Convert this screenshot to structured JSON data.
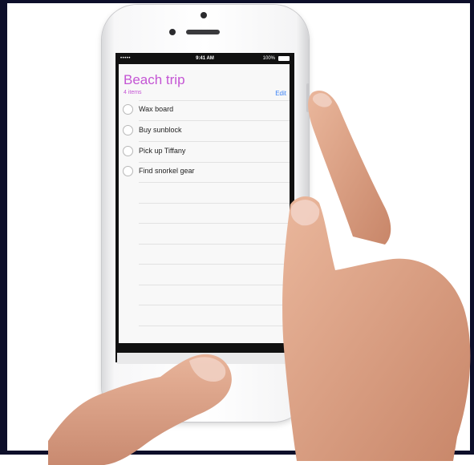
{
  "status_bar": {
    "signal": "•••••",
    "time": "9:41 AM",
    "battery": "100%"
  },
  "list": {
    "title": "Beach trip",
    "count": "4 items",
    "edit_label": "Edit",
    "items": [
      {
        "label": "Wax board"
      },
      {
        "label": "Buy sunblock"
      },
      {
        "label": "Pick up Tiffany"
      },
      {
        "label": "Find snorkel gear"
      }
    ]
  },
  "colors": {
    "title": "#c455d4",
    "edit": "#3a82f6"
  }
}
